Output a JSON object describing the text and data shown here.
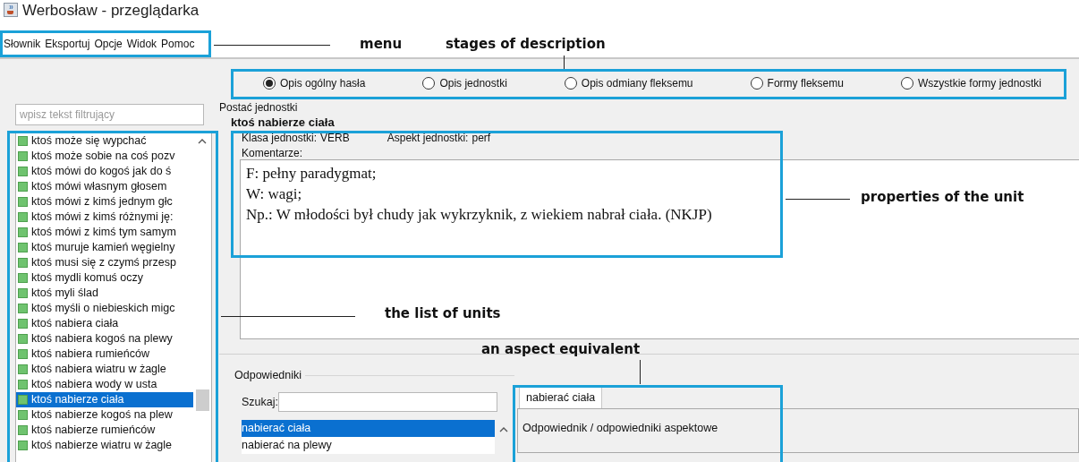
{
  "window": {
    "title": "Werbosław - przeglądarka"
  },
  "menu": [
    "Słownik",
    "Eksportuj",
    "Opcje",
    "Widok",
    "Pomoc"
  ],
  "filter": {
    "placeholder": "wpisz tekst filtrujący"
  },
  "units": [
    {
      "label": "ktoś może się wypchać",
      "selected": false
    },
    {
      "label": "ktoś może sobie na coś pozv",
      "selected": false
    },
    {
      "label": "ktoś mówi do kogoś jak do ś",
      "selected": false
    },
    {
      "label": "ktoś mówi własnym głosem",
      "selected": false
    },
    {
      "label": "ktoś mówi z kimś jednym głc",
      "selected": false
    },
    {
      "label": "ktoś mówi z kimś różnymi ję:",
      "selected": false
    },
    {
      "label": "ktoś mówi z kimś tym samym",
      "selected": false
    },
    {
      "label": "ktoś muruje kamień węgielny",
      "selected": false
    },
    {
      "label": "ktoś musi się z czymś przesp",
      "selected": false
    },
    {
      "label": "ktoś mydli komuś oczy",
      "selected": false
    },
    {
      "label": "ktoś myli ślad",
      "selected": false
    },
    {
      "label": "ktoś myśli o niebieskich migc",
      "selected": false
    },
    {
      "label": "ktoś nabiera ciała",
      "selected": false
    },
    {
      "label": "ktoś nabiera kogoś na plewy",
      "selected": false
    },
    {
      "label": "ktoś nabiera rumieńców",
      "selected": false
    },
    {
      "label": "ktoś nabiera wiatru w żagle",
      "selected": false
    },
    {
      "label": "ktoś nabiera wody w usta",
      "selected": false
    },
    {
      "label": "ktoś nabierze ciała",
      "selected": true
    },
    {
      "label": "ktoś nabierze kogoś na plew",
      "selected": false
    },
    {
      "label": "ktoś nabierze rumieńców",
      "selected": false
    },
    {
      "label": "ktoś nabierze wiatru w żagle",
      "selected": false
    }
  ],
  "stages": [
    {
      "label": "Opis ogólny hasła",
      "selected": true
    },
    {
      "label": "Opis jednostki",
      "selected": false
    },
    {
      "label": "Opis odmiany fleksemu",
      "selected": false
    },
    {
      "label": "Formy fleksemu",
      "selected": false
    },
    {
      "label": "Wszystkie formy jednostki",
      "selected": false
    }
  ],
  "unit": {
    "form_label": "Postać jednostki",
    "name": "ktoś nabierze ciała",
    "class_label": "Klasa jednostki:",
    "class_value": "VERB",
    "aspect_label": "Aspekt jednostki:",
    "aspect_value": "perf",
    "comments_label": "Komentarze:",
    "comments": [
      "F: pełny paradygmat;",
      "W: wagi;",
      "Np.: W młodości był chudy jak wykrzyknik, z wiekiem nabrał ciała. (NKJP)"
    ]
  },
  "equivalents": {
    "title": "Odpowiedniki",
    "search_label": "Szukaj:",
    "items": [
      {
        "label": "nabierać ciała",
        "selected": true
      },
      {
        "label": "nabierać na plewy",
        "selected": false
      }
    ],
    "tabs": [
      {
        "label": "nabierać ciała",
        "selected": true
      }
    ],
    "tab_content": "Odpowiednik / odpowiedniki aspektowe"
  },
  "annotations": {
    "menu": "menu",
    "stages": "stages of description",
    "properties": "properties of the unit",
    "list": "the list of units",
    "equivalent": "an aspect equivalent"
  }
}
